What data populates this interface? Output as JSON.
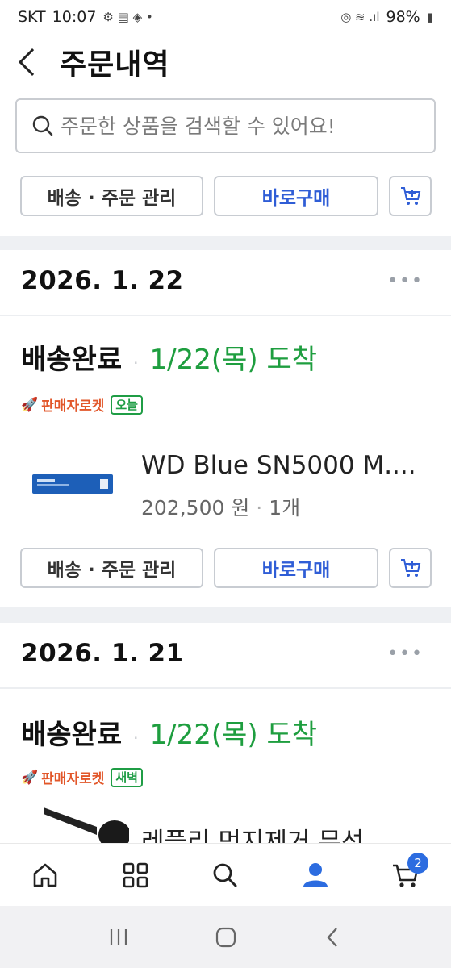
{
  "status_bar": {
    "carrier": "SKT",
    "time": "10:07",
    "battery": "98%"
  },
  "header": {
    "title": "주문내역"
  },
  "search": {
    "placeholder": "주문한 상품을 검색할 수 있어요!"
  },
  "top_actions": {
    "manage_label": "배송 · 주문 관리",
    "buy_label": "바로구매"
  },
  "orders": [
    {
      "date": "2026. 1. 22",
      "status": "배송완료",
      "arrival": "1/22(목) 도착",
      "rocket_label": "판매자로켓",
      "rocket_tag": "오늘",
      "product_name": "WD Blue SN5000 M....",
      "product_price": "202,500 원",
      "product_qty": "1개",
      "manage_label": "배송 · 주문 관리",
      "buy_label": "바로구매"
    },
    {
      "date": "2026. 1. 21",
      "status": "배송완료",
      "arrival": "1/22(목) 도착",
      "rocket_label": "판매자로켓",
      "rocket_tag": "새벽",
      "product_name": "레플리 먼지제거 무선"
    }
  ],
  "bottom_nav": {
    "cart_badge": "2"
  },
  "colors": {
    "accent": "#2f5dd6",
    "arrival_green": "#1e9e3f",
    "rocket_orange": "#e2572a"
  },
  "icons": [
    "back-icon",
    "search-icon",
    "add-cart-icon",
    "more-icon",
    "rocket-icon",
    "home-icon",
    "category-icon",
    "search-nav-icon",
    "user-icon",
    "cart-icon"
  ]
}
